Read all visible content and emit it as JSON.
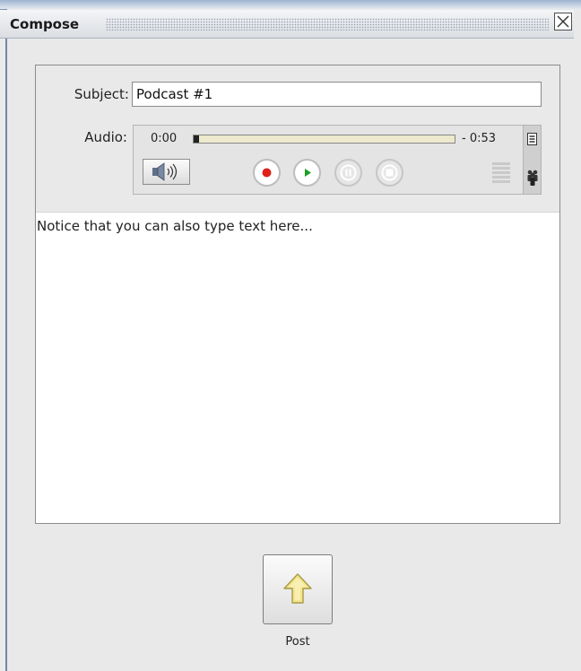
{
  "window": {
    "title": "Compose"
  },
  "form": {
    "subject_label": "Subject:",
    "subject_value": "Podcast #1",
    "audio_label": "Audio:"
  },
  "player": {
    "current_time": "0:00",
    "remaining_time": "- 0:53",
    "progress": 0.0,
    "controls": [
      "speaker-icon",
      "record-icon",
      "play-icon",
      "pause-icon",
      "stop-icon",
      "menu-icon",
      "people-icon"
    ],
    "record_color": "#e0201a",
    "play_color": "#1aa020"
  },
  "editor": {
    "text": "Notice that you can also type text here..."
  },
  "actions": {
    "post_label": "Post",
    "post_icon": "up-arrow-icon",
    "post_icon_color": "#f3e58a"
  }
}
